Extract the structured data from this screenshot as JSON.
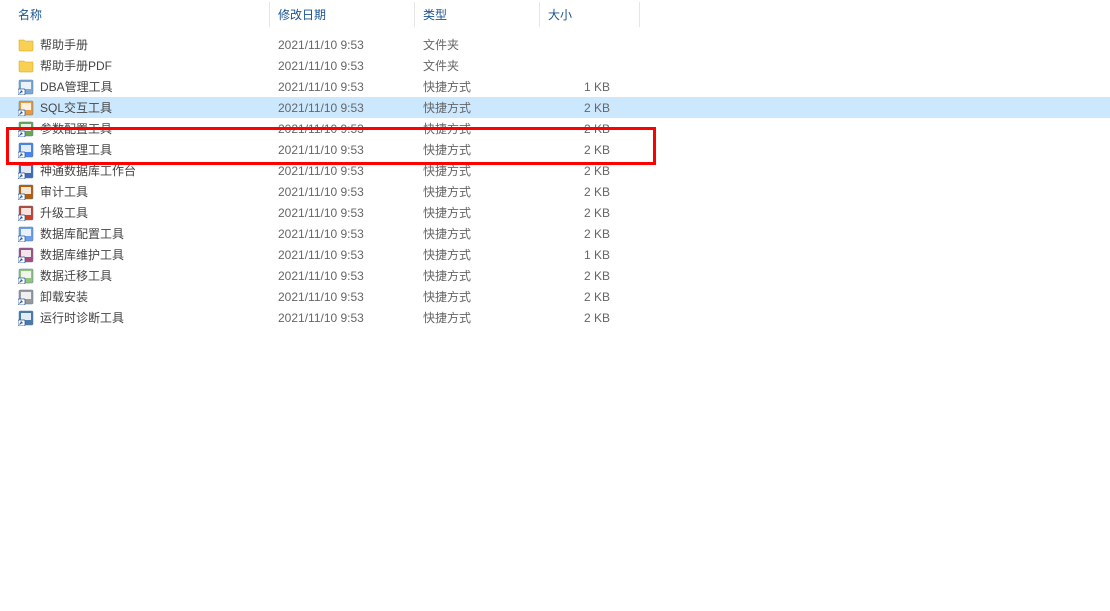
{
  "columns": {
    "name": "名称",
    "date": "修改日期",
    "type": "类型",
    "size": "大小"
  },
  "files": [
    {
      "name": "帮助手册",
      "date": "2021/11/10 9:53",
      "type": "文件夹",
      "size": "",
      "icon": "folder",
      "selected": false
    },
    {
      "name": "帮助手册PDF",
      "date": "2021/11/10 9:53",
      "type": "文件夹",
      "size": "",
      "icon": "folder",
      "selected": false
    },
    {
      "name": "DBA管理工具",
      "date": "2021/11/10 9:53",
      "type": "快捷方式",
      "size": "1 KB",
      "icon": "shortcut-db",
      "selected": false
    },
    {
      "name": "SQL交互工具",
      "date": "2021/11/10 9:53",
      "type": "快捷方式",
      "size": "2 KB",
      "icon": "shortcut-sql",
      "selected": true
    },
    {
      "name": "参数配置工具",
      "date": "2021/11/10 9:53",
      "type": "快捷方式",
      "size": "2 KB",
      "icon": "shortcut-config",
      "selected": false
    },
    {
      "name": "策略管理工具",
      "date": "2021/11/10 9:53",
      "type": "快捷方式",
      "size": "2 KB",
      "icon": "shortcut-policy",
      "selected": false
    },
    {
      "name": "神通数据库工作台",
      "date": "2021/11/10 9:53",
      "type": "快捷方式",
      "size": "2 KB",
      "icon": "shortcut-workbench",
      "selected": false
    },
    {
      "name": "审计工具",
      "date": "2021/11/10 9:53",
      "type": "快捷方式",
      "size": "2 KB",
      "icon": "shortcut-audit",
      "selected": false
    },
    {
      "name": "升级工具",
      "date": "2021/11/10 9:53",
      "type": "快捷方式",
      "size": "2 KB",
      "icon": "shortcut-upgrade",
      "selected": false
    },
    {
      "name": "数据库配置工具",
      "date": "2021/11/10 9:53",
      "type": "快捷方式",
      "size": "2 KB",
      "icon": "shortcut-dbconfig",
      "selected": false
    },
    {
      "name": "数据库维护工具",
      "date": "2021/11/10 9:53",
      "type": "快捷方式",
      "size": "1 KB",
      "icon": "shortcut-maint",
      "selected": false
    },
    {
      "name": "数据迁移工具",
      "date": "2021/11/10 9:53",
      "type": "快捷方式",
      "size": "2 KB",
      "icon": "shortcut-migrate",
      "selected": false
    },
    {
      "name": "卸载安装",
      "date": "2021/11/10 9:53",
      "type": "快捷方式",
      "size": "2 KB",
      "icon": "shortcut-uninstall",
      "selected": false
    },
    {
      "name": "运行时诊断工具",
      "date": "2021/11/10 9:53",
      "type": "快捷方式",
      "size": "2 KB",
      "icon": "shortcut-diag",
      "selected": false
    }
  ],
  "highlight": {
    "row_index": 3
  }
}
